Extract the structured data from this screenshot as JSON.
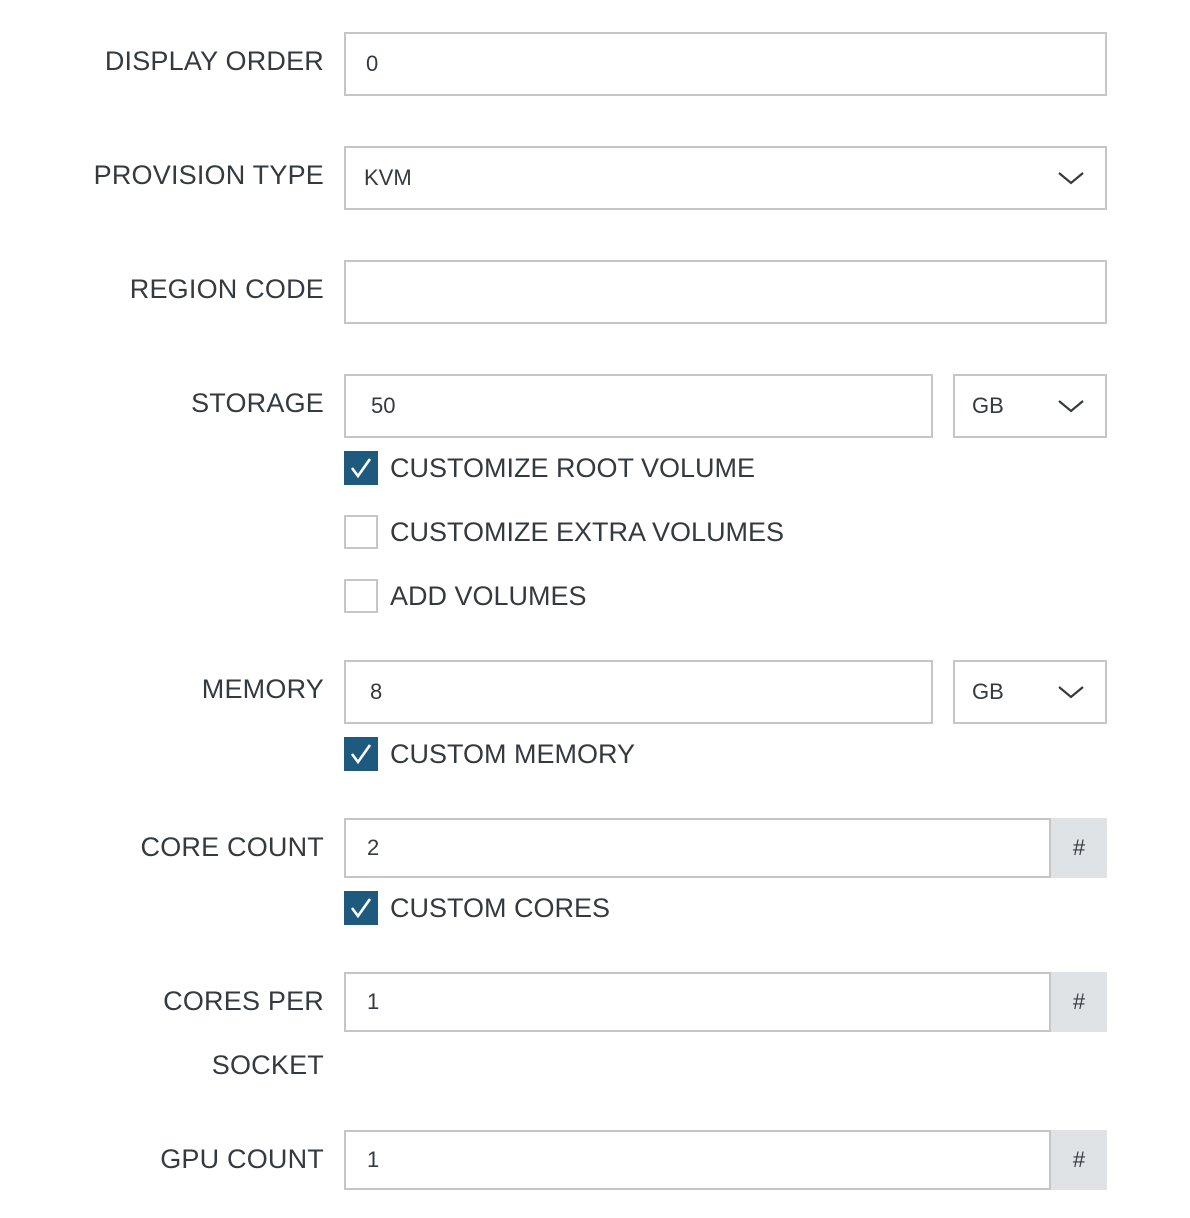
{
  "form": {
    "display_order": {
      "label": "DISPLAY ORDER",
      "value": "0"
    },
    "provision_type": {
      "label": "PROVISION TYPE",
      "value": "KVM"
    },
    "region_code": {
      "label": "REGION CODE",
      "value": ""
    },
    "storage": {
      "label": "STORAGE",
      "value": "50",
      "unit": "GB",
      "options": [
        {
          "label": "CUSTOMIZE ROOT VOLUME",
          "checked": true
        },
        {
          "label": "CUSTOMIZE EXTRA VOLUMES",
          "checked": false
        },
        {
          "label": "ADD VOLUMES",
          "checked": false
        }
      ]
    },
    "memory": {
      "label": "MEMORY",
      "value": "8",
      "unit": "GB",
      "options": [
        {
          "label": "CUSTOM MEMORY",
          "checked": true
        }
      ]
    },
    "core_count": {
      "label": "CORE COUNT",
      "value": "2",
      "addon": "#",
      "options": [
        {
          "label": "CUSTOM CORES",
          "checked": true
        }
      ]
    },
    "cores_per_socket": {
      "label_line1": "CORES PER",
      "label_line2": "SOCKET",
      "value": "1",
      "addon": "#"
    },
    "gpu_count": {
      "label": "GPU COUNT",
      "value": "1",
      "addon": "#"
    }
  },
  "colors": {
    "checkbox_checked": "#1e5a7e",
    "input_border": "#c6c6c6",
    "addon_bg": "#dfe3e6",
    "text": "#333a40"
  },
  "icons": {
    "dropdown": "chevron-down-icon",
    "check": "checkmark-icon"
  }
}
